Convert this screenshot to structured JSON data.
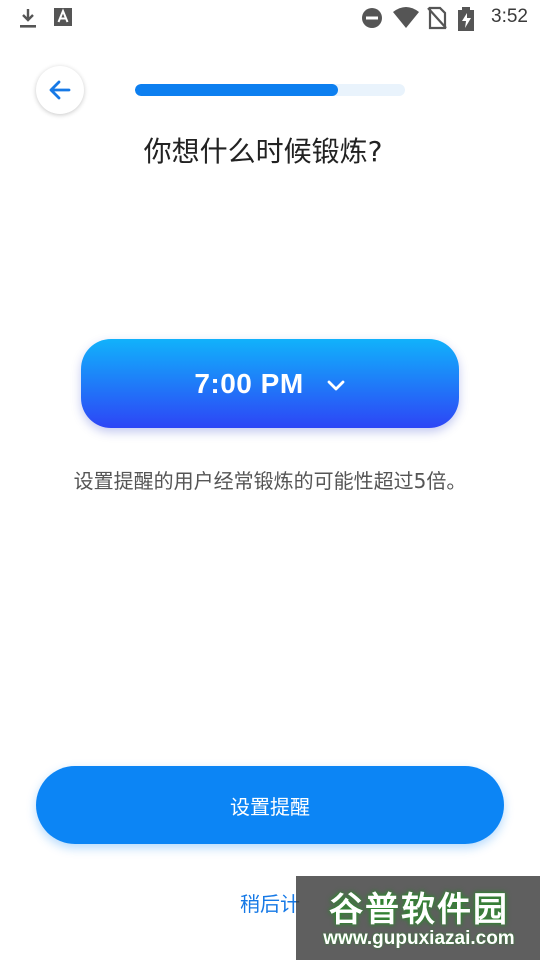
{
  "status_bar": {
    "time": "3:52",
    "icons": [
      "download-icon",
      "font-a-icon",
      "dnd-icon",
      "wifi-icon",
      "no-sim-icon",
      "battery-charging-icon"
    ]
  },
  "progress": {
    "fraction": 0.75
  },
  "title": "你想什么时候锻炼?",
  "time_picker": {
    "value": "7:00 PM",
    "icon": "chevron-down-icon"
  },
  "hint": "设置提醒的用户经常锻炼的可能性超过5倍。",
  "primary_button": {
    "label": "设置提醒"
  },
  "later_link": {
    "label": "稍后计"
  },
  "watermark": {
    "title": "谷普软件园",
    "url": "www.gupuxiazai.com"
  },
  "colors": {
    "accent": "#0c85f5",
    "gradient_top": "#11b2fb",
    "gradient_bottom": "#2d45f6",
    "progress_track": "#e9f3fc"
  }
}
